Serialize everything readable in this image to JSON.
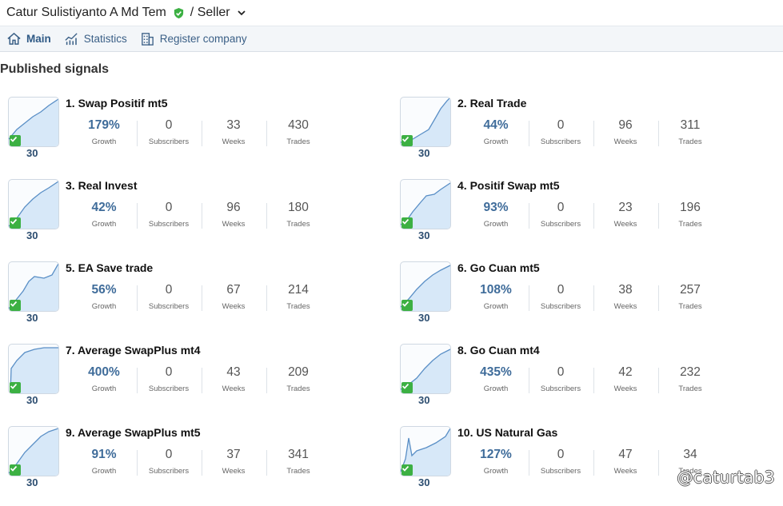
{
  "header": {
    "user_name": "Catur Sulistiyanto A Md Tem",
    "role": "/ Seller"
  },
  "nav": {
    "items": [
      {
        "label": "Main",
        "icon": "home-icon",
        "active": true
      },
      {
        "label": "Statistics",
        "icon": "chart-icon",
        "active": false
      },
      {
        "label": "Register company",
        "icon": "building-icon",
        "active": false
      }
    ]
  },
  "section_title": "Published signals",
  "labels": {
    "growth": "Growth",
    "subscribers": "Subscribers",
    "weeks": "Weeks",
    "trades": "Trades"
  },
  "signals": [
    {
      "name": "1. Swap Positif mt5",
      "badge": "30",
      "growth": "179%",
      "subscribers": "0",
      "weeks": "33",
      "trades": "430"
    },
    {
      "name": "2. Real Trade",
      "badge": "30",
      "growth": "44%",
      "subscribers": "0",
      "weeks": "96",
      "trades": "311"
    },
    {
      "name": "3. Real Invest",
      "badge": "30",
      "growth": "42%",
      "subscribers": "0",
      "weeks": "96",
      "trades": "180"
    },
    {
      "name": "4. Positif Swap mt5",
      "badge": "30",
      "growth": "93%",
      "subscribers": "0",
      "weeks": "23",
      "trades": "196"
    },
    {
      "name": "5. EA Save trade",
      "badge": "30",
      "growth": "56%",
      "subscribers": "0",
      "weeks": "67",
      "trades": "214"
    },
    {
      "name": "6. Go Cuan mt5",
      "badge": "30",
      "growth": "108%",
      "subscribers": "0",
      "weeks": "38",
      "trades": "257"
    },
    {
      "name": "7. Average SwapPlus mt4",
      "badge": "30",
      "growth": "400%",
      "subscribers": "0",
      "weeks": "43",
      "trades": "209"
    },
    {
      "name": "8. Go Cuan mt4",
      "badge": "30",
      "growth": "435%",
      "subscribers": "0",
      "weeks": "42",
      "trades": "232"
    },
    {
      "name": "9. Average SwapPlus mt5",
      "badge": "30",
      "growth": "91%",
      "subscribers": "0",
      "weeks": "37",
      "trades": "341"
    },
    {
      "name": "10. US Natural Gas",
      "badge": "30",
      "growth": "127%",
      "subscribers": "0",
      "weeks": "47",
      "trades": "34"
    }
  ],
  "watermark": "@caturtab3",
  "colors": {
    "accent": "#3f6c9a",
    "verified": "#3cb043",
    "nav_bg": "#f3f6f9"
  }
}
